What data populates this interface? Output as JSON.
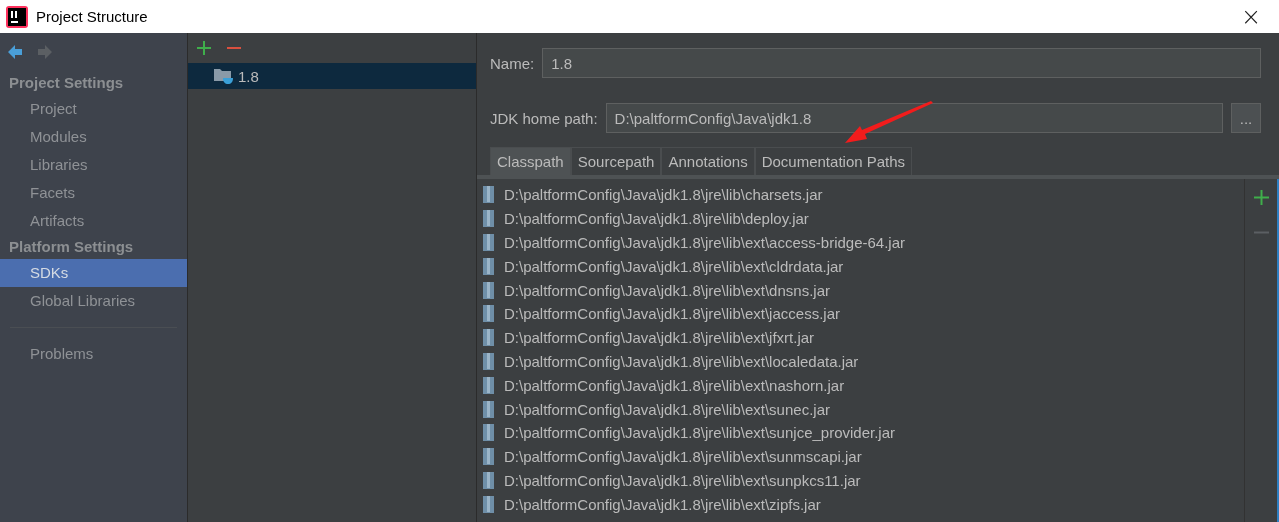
{
  "window": {
    "title": "Project Structure",
    "close": "×"
  },
  "nav": [
    {
      "kind": "back",
      "disabled": false
    },
    {
      "kind": "forward",
      "disabled": true
    }
  ],
  "sidebar": [
    {
      "kind": "header",
      "label": "Project Settings"
    },
    {
      "kind": "item",
      "label": "Project",
      "selected": false
    },
    {
      "kind": "item",
      "label": "Modules",
      "selected": false
    },
    {
      "kind": "item",
      "label": "Libraries",
      "selected": false
    },
    {
      "kind": "item",
      "label": "Facets",
      "selected": false
    },
    {
      "kind": "item",
      "label": "Artifacts",
      "selected": false
    },
    {
      "kind": "header",
      "label": "Platform Settings"
    },
    {
      "kind": "item",
      "label": "SDKs",
      "selected": true
    },
    {
      "kind": "item",
      "label": "Global Libraries",
      "selected": false
    },
    {
      "kind": "separator"
    },
    {
      "kind": "item",
      "label": "Problems",
      "selected": false
    }
  ],
  "sdk_toolbar": [
    {
      "kind": "add",
      "disabled": false
    },
    {
      "kind": "remove",
      "disabled": false
    }
  ],
  "sdk_list": [
    {
      "label": "1.8",
      "selected": true
    }
  ],
  "name_field": {
    "label": "Name:",
    "value": "1.8"
  },
  "home_path": {
    "label": "JDK home path:",
    "value": "D:\\paltformConfig\\Java\\jdk1.8",
    "browse": "..."
  },
  "tabs": [
    {
      "label": "Classpath",
      "selected": true
    },
    {
      "label": "Sourcepath",
      "selected": false
    },
    {
      "label": "Annotations",
      "selected": false
    },
    {
      "label": "Documentation Paths",
      "selected": false
    }
  ],
  "classpath": [
    "D:\\paltformConfig\\Java\\jdk1.8\\jre\\lib\\charsets.jar",
    "D:\\paltformConfig\\Java\\jdk1.8\\jre\\lib\\deploy.jar",
    "D:\\paltformConfig\\Java\\jdk1.8\\jre\\lib\\ext\\access-bridge-64.jar",
    "D:\\paltformConfig\\Java\\jdk1.8\\jre\\lib\\ext\\cldrdata.jar",
    "D:\\paltformConfig\\Java\\jdk1.8\\jre\\lib\\ext\\dnsns.jar",
    "D:\\paltformConfig\\Java\\jdk1.8\\jre\\lib\\ext\\jaccess.jar",
    "D:\\paltformConfig\\Java\\jdk1.8\\jre\\lib\\ext\\jfxrt.jar",
    "D:\\paltformConfig\\Java\\jdk1.8\\jre\\lib\\ext\\localedata.jar",
    "D:\\paltformConfig\\Java\\jdk1.8\\jre\\lib\\ext\\nashorn.jar",
    "D:\\paltformConfig\\Java\\jdk1.8\\jre\\lib\\ext\\sunec.jar",
    "D:\\paltformConfig\\Java\\jdk1.8\\jre\\lib\\ext\\sunjce_provider.jar",
    "D:\\paltformConfig\\Java\\jdk1.8\\jre\\lib\\ext\\sunmscapi.jar",
    "D:\\paltformConfig\\Java\\jdk1.8\\jre\\lib\\ext\\sunpkcs11.jar",
    "D:\\paltformConfig\\Java\\jdk1.8\\jre\\lib\\ext\\zipfs.jar"
  ],
  "classpath_toolbar": [
    {
      "kind": "add",
      "disabled": false
    },
    {
      "kind": "remove",
      "disabled": true
    }
  ]
}
